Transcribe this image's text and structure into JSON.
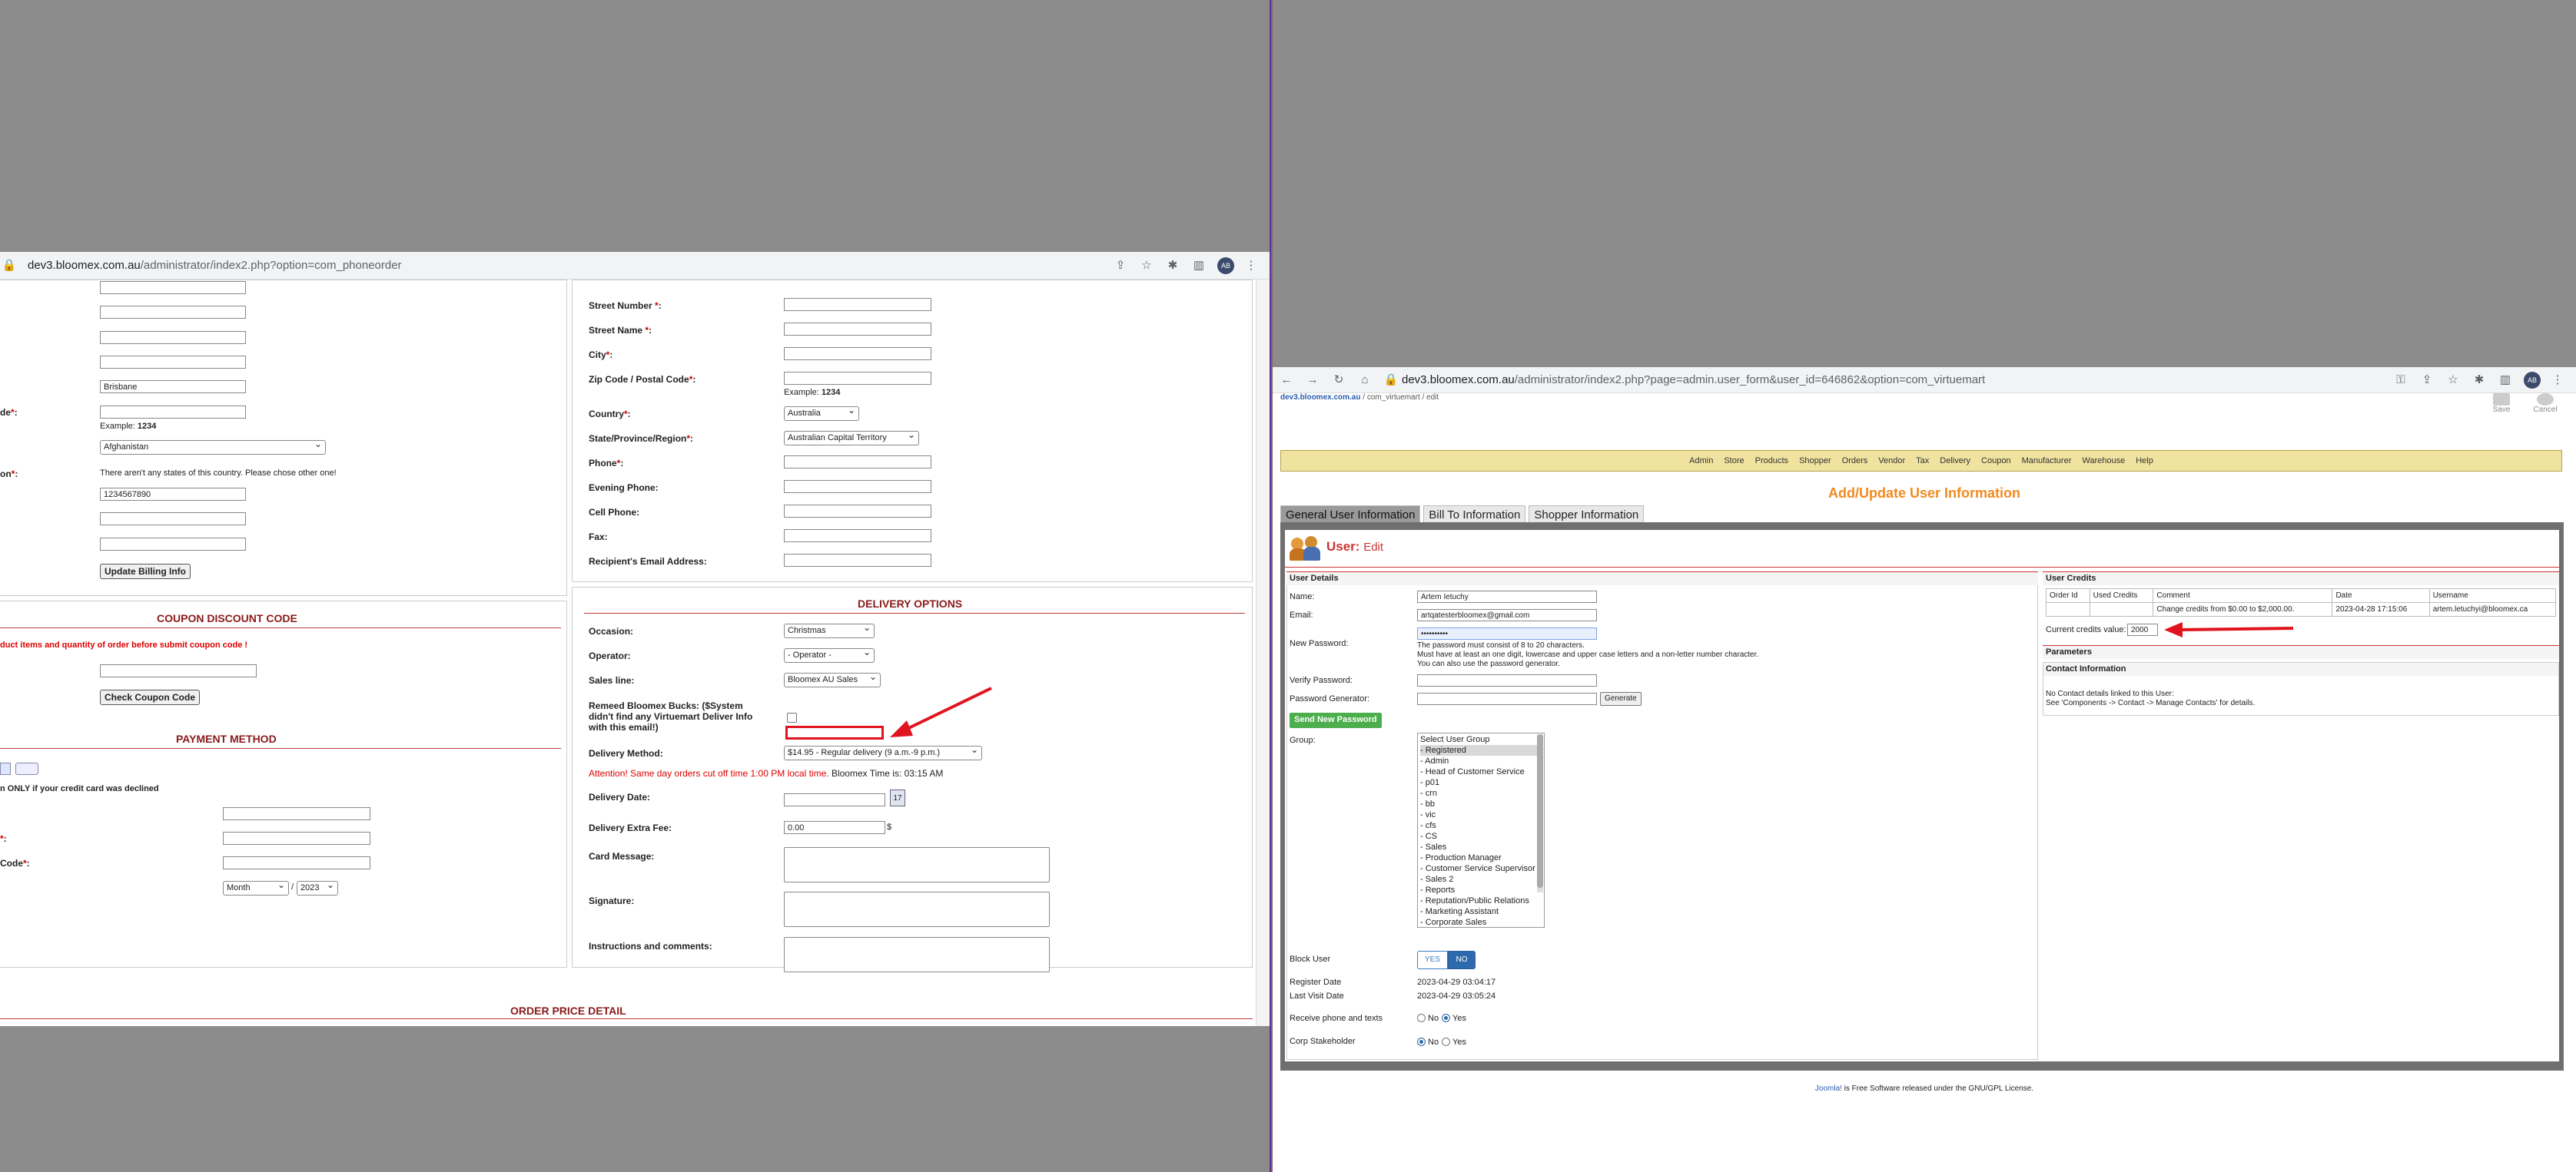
{
  "left_window": {
    "url_host": "dev3.bloomex.com.au",
    "url_path": "/administrator/index2.php?option=com_phoneorder",
    "billing": {
      "city_value": "Brisbane",
      "zip_label_partial": "de",
      "zip_example_prefix": "Example:",
      "zip_example": "1234",
      "country_value": "Afghanistan",
      "region_label_partial": "on",
      "region_message": "There aren't any states of this country. Please chose other one!",
      "phone_value": "1234567890",
      "update_button": "Update Billing Info"
    },
    "coupon": {
      "title": "COUPON DISCOUNT CODE",
      "warning": "duct items and quantity of order before submit coupon code !",
      "check_button": "Check Coupon Code"
    },
    "payment": {
      "title": "PAYMENT METHOD",
      "declined_note": "n ONLY if your credit card was declined",
      "field2_label": ":",
      "field3_label": "Code",
      "month": "Month",
      "year": "2023"
    },
    "shipping": {
      "street_number": "Street Number",
      "street_name": "Street Name",
      "city": "City",
      "zip": "Zip Code / Postal Code",
      "zip_example_prefix": "Example:",
      "zip_example": "1234",
      "country": "Country",
      "country_value": "Australia",
      "state": "State/Province/Region",
      "state_value": "Australian Capital Territory",
      "phone": "Phone",
      "evening_phone": "Evening Phone:",
      "cell_phone": "Cell Phone:",
      "fax": "Fax:",
      "recipient_email": "Recipient's Email Address:"
    },
    "delivery": {
      "title": "DELIVERY OPTIONS",
      "occasion_label": "Occasion:",
      "occasion_value": "Christmas",
      "operator_label": "Operator:",
      "operator_value": "- Operator -",
      "sales_line_label": "Sales line:",
      "sales_line_value": "Bloomex AU Sales",
      "bucks_label_1": "Remeed Bloomex Bucks: ($System",
      "bucks_label_2": "didn't find any Virtuemart Deliver Info",
      "bucks_label_3": "with this email!)",
      "method_label": "Delivery Method:",
      "method_value": "$14.95 - Regular delivery (9 a.m.-9 p.m.)",
      "attention": "Attention! Same day orders cut off time 1:00 PM local time.",
      "time_text": "Bloomex Time is: 03:15 AM",
      "date_label": "Delivery Date:",
      "extra_fee_label": "Delivery Extra Fee:",
      "extra_fee_value": "0.00",
      "extra_fee_unit": "$",
      "card_message_label": "Card Message:",
      "signature_label": "Signature:",
      "instructions_label": "Instructions and comments:"
    },
    "order_price_title": "ORDER PRICE DETAIL",
    "annotation_color": "#e0141e"
  },
  "right_window": {
    "url_host": "dev3.bloomex.com.au",
    "url_path": "/administrator/index2.php?page=admin.user_form&user_id=646862&option=com_virtuemart",
    "breadcrumb_host": "dev3.bloomex.com.au",
    "breadcrumb_rest": " / com_virtuemart / edit",
    "save_label": "Save",
    "cancel_label": "Cancel",
    "menu": [
      "Admin",
      "Store",
      "Products",
      "Shopper",
      "Orders",
      "Vendor",
      "Tax",
      "Delivery",
      "Coupon",
      "Manufacturer",
      "Warehouse",
      "Help"
    ],
    "title": "Add/Update User Information",
    "tabs": [
      "General User Information",
      "Bill To Information",
      "Shopper Information"
    ],
    "user_edit_prefix": "User:",
    "user_edit_suffix": "Edit",
    "details": {
      "header": "User Details",
      "name_label": "Name:",
      "name_value": "Artem Ietuchy",
      "email_label": "Email:",
      "email_value": "artqatesterbloomex@gmail.com",
      "new_password_label": "New Password:",
      "password_value": "••••••••••",
      "password_note_1": "The password must consist of 8 to 20 characters.",
      "password_note_2": "Must have at least an one digit, lowercase and upper case letters and a non-letter number character.",
      "password_note_3": "You can also use the password generator.",
      "verify_label": "Verify Password:",
      "generator_label": "Password Generator:",
      "generate_button": "Generate",
      "send_password_button": "Send New Password",
      "group_label": "Group:",
      "groups": [
        "Select User Group",
        "- Registered",
        "- Admin",
        "- Head of Customer Service",
        "- p01",
        "- crn",
        "- bb",
        "- vic",
        "- cfs",
        "- CS",
        "- Sales",
        "- Production Manager",
        "- Customer Service Supervisor",
        "- Sales 2",
        "- Reports",
        "- Reputation/Public Relations",
        "- Marketing Assistant",
        "- Corporate Sales"
      ],
      "block_label": "Block User",
      "block_yes": "YES",
      "block_no": "NO",
      "register_label": "Register Date",
      "register_value": "2023-04-29 03:04:17",
      "last_visit_label": "Last Visit Date",
      "last_visit_value": "2023-04-29 03:05:24",
      "phone_texts_label": "Receive phone and texts",
      "corp_label": "Corp Stakeholder",
      "no_label": "No",
      "yes_label": "Yes"
    },
    "credits": {
      "header": "User Credits",
      "columns": [
        "Order Id",
        "Used Credits",
        "Comment",
        "Date",
        "Username"
      ],
      "row": [
        "",
        "",
        "Change credits from $0.00 to $2,000.00.",
        "2023-04-28 17:15:06",
        "artem.letuchyi@bloomex.ca"
      ],
      "current_label": "Current credits value:",
      "current_value": "2000"
    },
    "parameters_header": "Parameters",
    "contact_header": "Contact Information",
    "contact_line1": "No Contact details linked to this User:",
    "contact_line2": "See 'Components -> Contact -> Manage Contacts' for details.",
    "footer_link": "Joomla!",
    "footer_text": " is Free Software released under the GNU/GPL License."
  }
}
